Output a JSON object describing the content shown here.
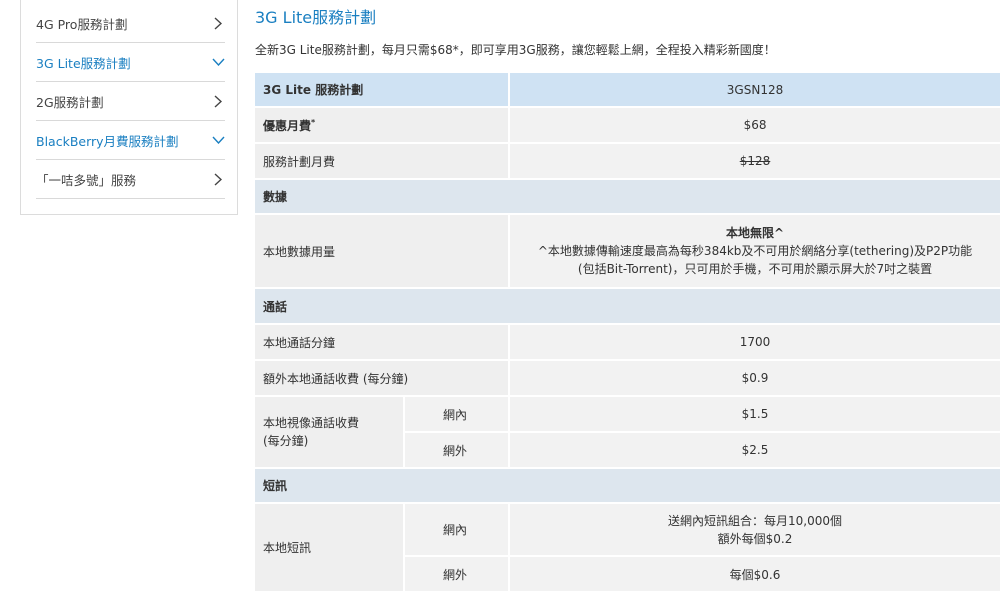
{
  "sidebar": {
    "items": [
      {
        "label": "4G Pro服務計劃",
        "state": "collapsed"
      },
      {
        "label": "3G Lite服務計劃",
        "state": "expanded"
      },
      {
        "label": "2G服務計劃",
        "state": "collapsed"
      },
      {
        "label": "BlackBerry月費服務計劃",
        "state": "expanded"
      },
      {
        "label": "「一咭多號」服務",
        "state": "collapsed"
      }
    ]
  },
  "main": {
    "title": "3G Lite服務計劃",
    "subtitle": "全新3G Lite服務計劃，每月只需$68*，即可享用3G服務，讓您輕鬆上網，全程投入精彩新國度！"
  },
  "table": {
    "header_label": "3G Lite 服務計劃",
    "header_value": "3GSN128",
    "promo_fee_label": "優惠月費",
    "promo_fee_mark": "*",
    "promo_fee_value": "$68",
    "plan_fee_label": "服務計劃月費",
    "plan_fee_value": "$128",
    "section_data": "數據",
    "local_data_label": "本地數據用量",
    "local_data_line1": "本地無限^",
    "local_data_line2": "^本地數據傳輸速度最高為每秒384kb及不可用於網絡分享(tethering)及P2P功能",
    "local_data_line3": "(包括Bit-Torrent)，只可用於手機，不可用於顯示屏大於7吋之裝置",
    "section_call": "通話",
    "local_min_label": "本地通話分鐘",
    "local_min_value": "1700",
    "extra_call_label": "額外本地通話收費 (每分鐘)",
    "extra_call_value": "$0.9",
    "video_label_1": "本地視像通話收費",
    "video_label_2": "(每分鐘)",
    "video_in_label": "網內",
    "video_in_value": "$1.5",
    "video_out_label": "網外",
    "video_out_value": "$2.5",
    "section_sms": "短訊",
    "sms_label": "本地短訊",
    "sms_in_label": "網內",
    "sms_in_line1": "送網內短訊組合：每月10,000個",
    "sms_in_line2": "額外每個$0.2",
    "sms_out_label": "網外",
    "sms_out_value": "每個$0.6"
  }
}
